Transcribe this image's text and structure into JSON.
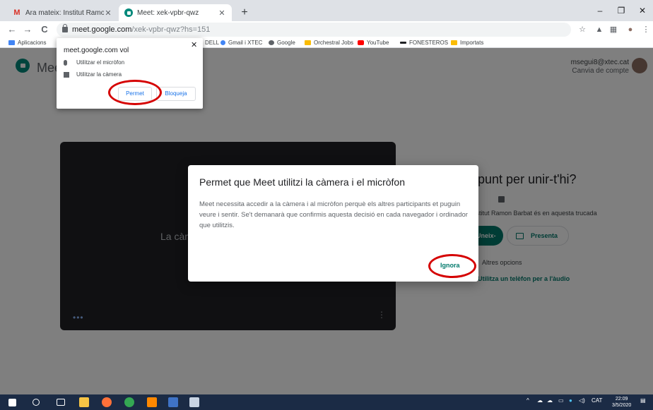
{
  "browser": {
    "tabs": [
      {
        "title": "Ara mateix: Institut Ramon Barba",
        "close": "✕"
      },
      {
        "title": "Meet: xek-vpbr-qwz",
        "close": "✕"
      }
    ],
    "new_tab": "+",
    "window_controls": {
      "minimize": "–",
      "maximize": "❐",
      "close": "✕"
    },
    "nav": {
      "back": "←",
      "forward": "→",
      "reload": "C"
    },
    "address": {
      "host": "meet.google.com",
      "path": "/xek-vpbr-qwz?hs=151"
    },
    "bookmarks": [
      {
        "label": "Aplicacions",
        "color": "#4285f4"
      },
      {
        "label": "DELL",
        "color": "#ffffff"
      },
      {
        "label": "Gmail i XTEC",
        "color": "#4285f4"
      },
      {
        "label": "Google",
        "color": "#5f6368"
      },
      {
        "label": "Orchestral Jobs",
        "color": "#fbbc04"
      },
      {
        "label": "YouTube",
        "color": "#ff0000"
      },
      {
        "label": "FONESTEROS",
        "color": "#202124"
      },
      {
        "label": "Importats",
        "color": "#fbbc04"
      }
    ]
  },
  "permission_popup": {
    "title": "meet.google.com vol",
    "close": "✕",
    "items": [
      "Utilitzar el micròfon",
      "Utilitzar la càmera"
    ],
    "allow_label": "Permet",
    "block_label": "Bloqueja"
  },
  "meet": {
    "logo_text": "Meet",
    "account_email": "msegui8@xtec.cat",
    "account_switch": "Canvia de compte",
    "video_text": "La càmera està desactivada",
    "video_dots": "•••",
    "video_more": "⋮",
    "join_title": "A punt per unir-t'hi?",
    "join_sub": "Institut Ramon Barbat és en aquesta trucada",
    "join_button": "Uneix-t'hi ara",
    "present_button": "Presenta",
    "more_options": "Altres opcions",
    "phone_link": "Utilitza un telèfon per a l'àudio"
  },
  "dialog": {
    "title": "Permet que Meet utilitzi la càmera i el micròfon",
    "body": "Meet necessita accedir a la càmera i al micròfon perquè els altres participants et puguin veure i sentir. Se't demanarà que confirmis aquesta decisió en cada navegador i ordinador que utilitzis.",
    "ignore_label": "Ignora"
  },
  "taskbar": {
    "language": "CAT",
    "time": "22:09",
    "date": "3/5/2020"
  },
  "colors": {
    "accent": "#00796b",
    "annotation": "#d50000",
    "taskbar": "#1b2b45"
  }
}
